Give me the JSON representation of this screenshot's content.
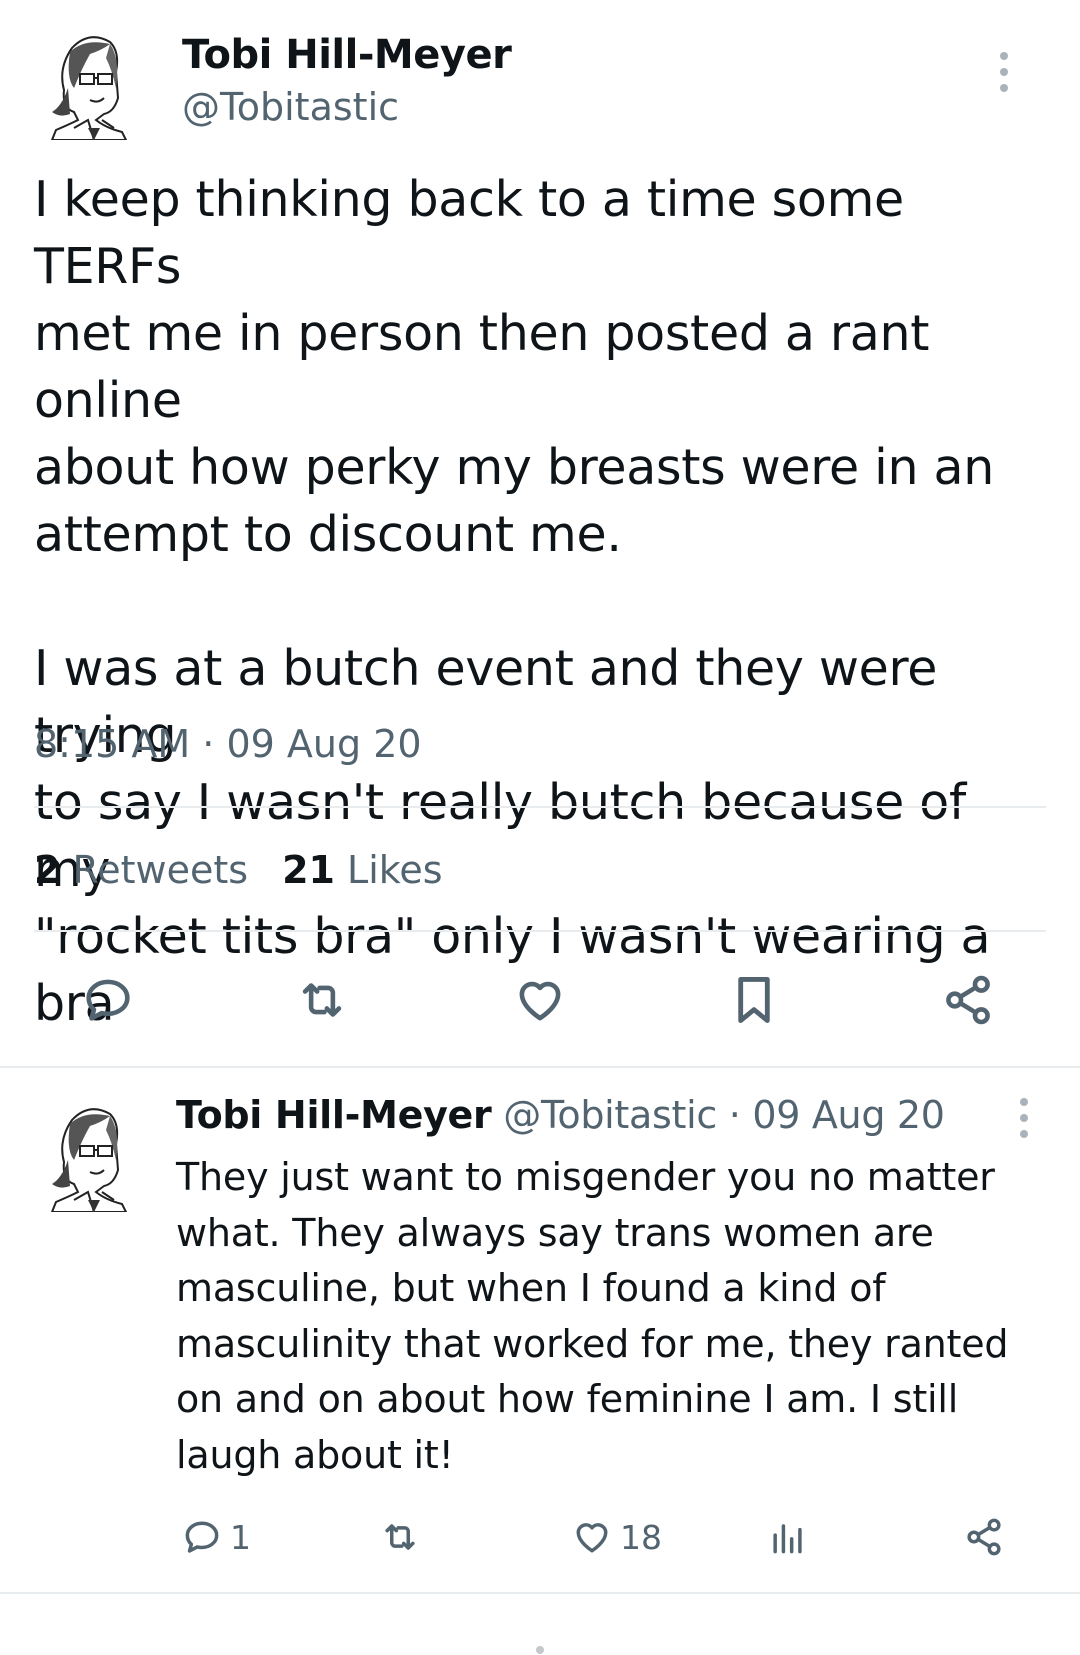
{
  "tweet": {
    "author_name": "Tobi Hill-Meyer",
    "author_handle": "@Tobitastic",
    "text": "I keep thinking back to a time some TERFs\nmet me in person then posted a rant online\nabout how perky my breasts were in an\nattempt to discount me.\n\nI was at a butch event and they were trying\nto say I wasn't really butch because of my\n\"rocket tits bra\" only I wasn't wearing a bra",
    "time": "8:15 AM",
    "separator": "·",
    "date": "09 Aug 20",
    "retweets_count": "2",
    "retweets_label": "Retweets",
    "likes_count": "21",
    "likes_label": "Likes",
    "actions": [
      "reply-icon",
      "retweet-icon",
      "like-icon",
      "bookmark-icon",
      "share-icon"
    ]
  },
  "reply": {
    "author_name": "Tobi Hill-Meyer",
    "author_handle": "@Tobitastic",
    "separator": "·",
    "date": "09 Aug 20",
    "text": "They just want to misgender you no matter\nwhat. They always say trans women are\nmasculine, but when I found a kind of\nmasculinity that worked for me, they ranted\non and on about how feminine I am. I still\nlaugh about it!",
    "reply_count": "1",
    "like_count": "18"
  },
  "colors": {
    "text": "#0f1419",
    "secondary": "#536471",
    "divider": "#e8ecef"
  }
}
